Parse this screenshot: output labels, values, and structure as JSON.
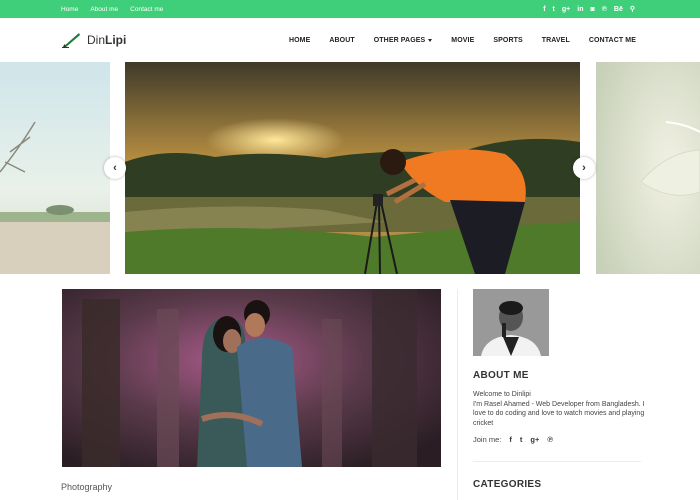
{
  "topbar": {
    "links": [
      "Home",
      "About me",
      "Contact me"
    ],
    "social": [
      {
        "icon": "facebook-icon",
        "glyph": "f"
      },
      {
        "icon": "twitter-icon",
        "glyph": "t"
      },
      {
        "icon": "google-plus-icon",
        "glyph": "g+"
      },
      {
        "icon": "linkedin-icon",
        "glyph": "in"
      },
      {
        "icon": "instagram-icon",
        "glyph": "◙"
      },
      {
        "icon": "pinterest-icon",
        "glyph": "℗"
      },
      {
        "icon": "behance-icon",
        "glyph": "Bē"
      },
      {
        "icon": "search-icon",
        "glyph": "⚲"
      }
    ],
    "color": "#3fcf7a"
  },
  "brand": {
    "part1": "Din",
    "part2": "Lipi"
  },
  "nav": {
    "home": "HOME",
    "about": "ABOUT",
    "other": "OTHER PAGES",
    "movie": "MOVIE",
    "sports": "SPORTS",
    "travel": "TRAVEL",
    "contact": "CONTACT ME"
  },
  "slider": {
    "prev": "‹",
    "next": "›"
  },
  "post": {
    "category": "Photography"
  },
  "sidebar": {
    "about_title": "ABOUT ME",
    "about_lines": [
      "Welcome to Dinlipi",
      "I'm Rasel Ahamed - Web Developer from Bangladesh. I love to do coding and love to watch movies and playing cricket"
    ],
    "join_label": "Join me:",
    "join_icons": [
      {
        "icon": "facebook-icon",
        "glyph": "f"
      },
      {
        "icon": "twitter-icon",
        "glyph": "t"
      },
      {
        "icon": "google-plus-icon",
        "glyph": "g+"
      },
      {
        "icon": "pinterest-icon",
        "glyph": "℗"
      }
    ],
    "categories_title": "CATEGORIES"
  }
}
